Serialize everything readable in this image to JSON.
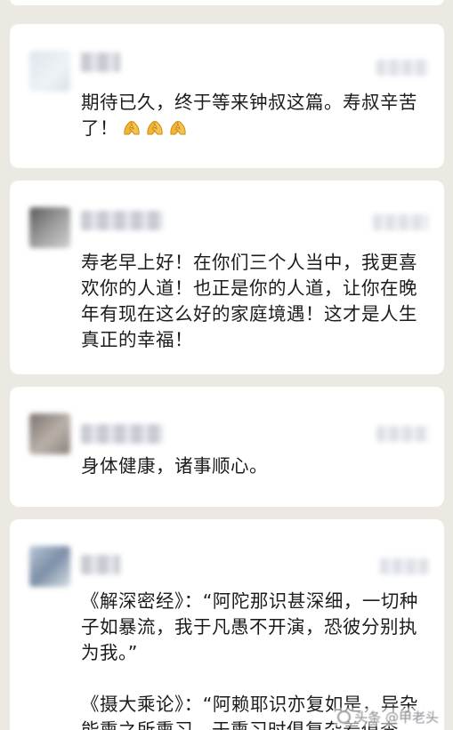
{
  "comments": [
    {
      "text": "期待已久，终于等来钟叔这篇。寿叔辛苦了！",
      "emoji": [
        "hands-icon",
        "hands-icon",
        "hands-icon"
      ]
    },
    {
      "text": "寿老早上好！在你们三个人当中，我更喜欢你的人道！也正是你的人道，让你在晚年有现在这么好的家庭境遇！这才是人生真正的幸福！"
    },
    {
      "text": "身体健康，诸事顺心。"
    },
    {
      "text": "《解深密经》：“阿陀那识甚深细，一切种子如暴流，我于凡愚不开演，恐彼分别执为我。”\n\n《摄大乘论》：“阿赖耶识亦复如是，异杂能熏之所熏习，于熏习时俱复杂着俱李"
    }
  ],
  "watermark": {
    "text": "头条 @甲老头"
  },
  "colors": {
    "background": "#ece8e2",
    "card": "#ffffff",
    "text": "#1c1c1c",
    "emoji": "#f2b632"
  }
}
